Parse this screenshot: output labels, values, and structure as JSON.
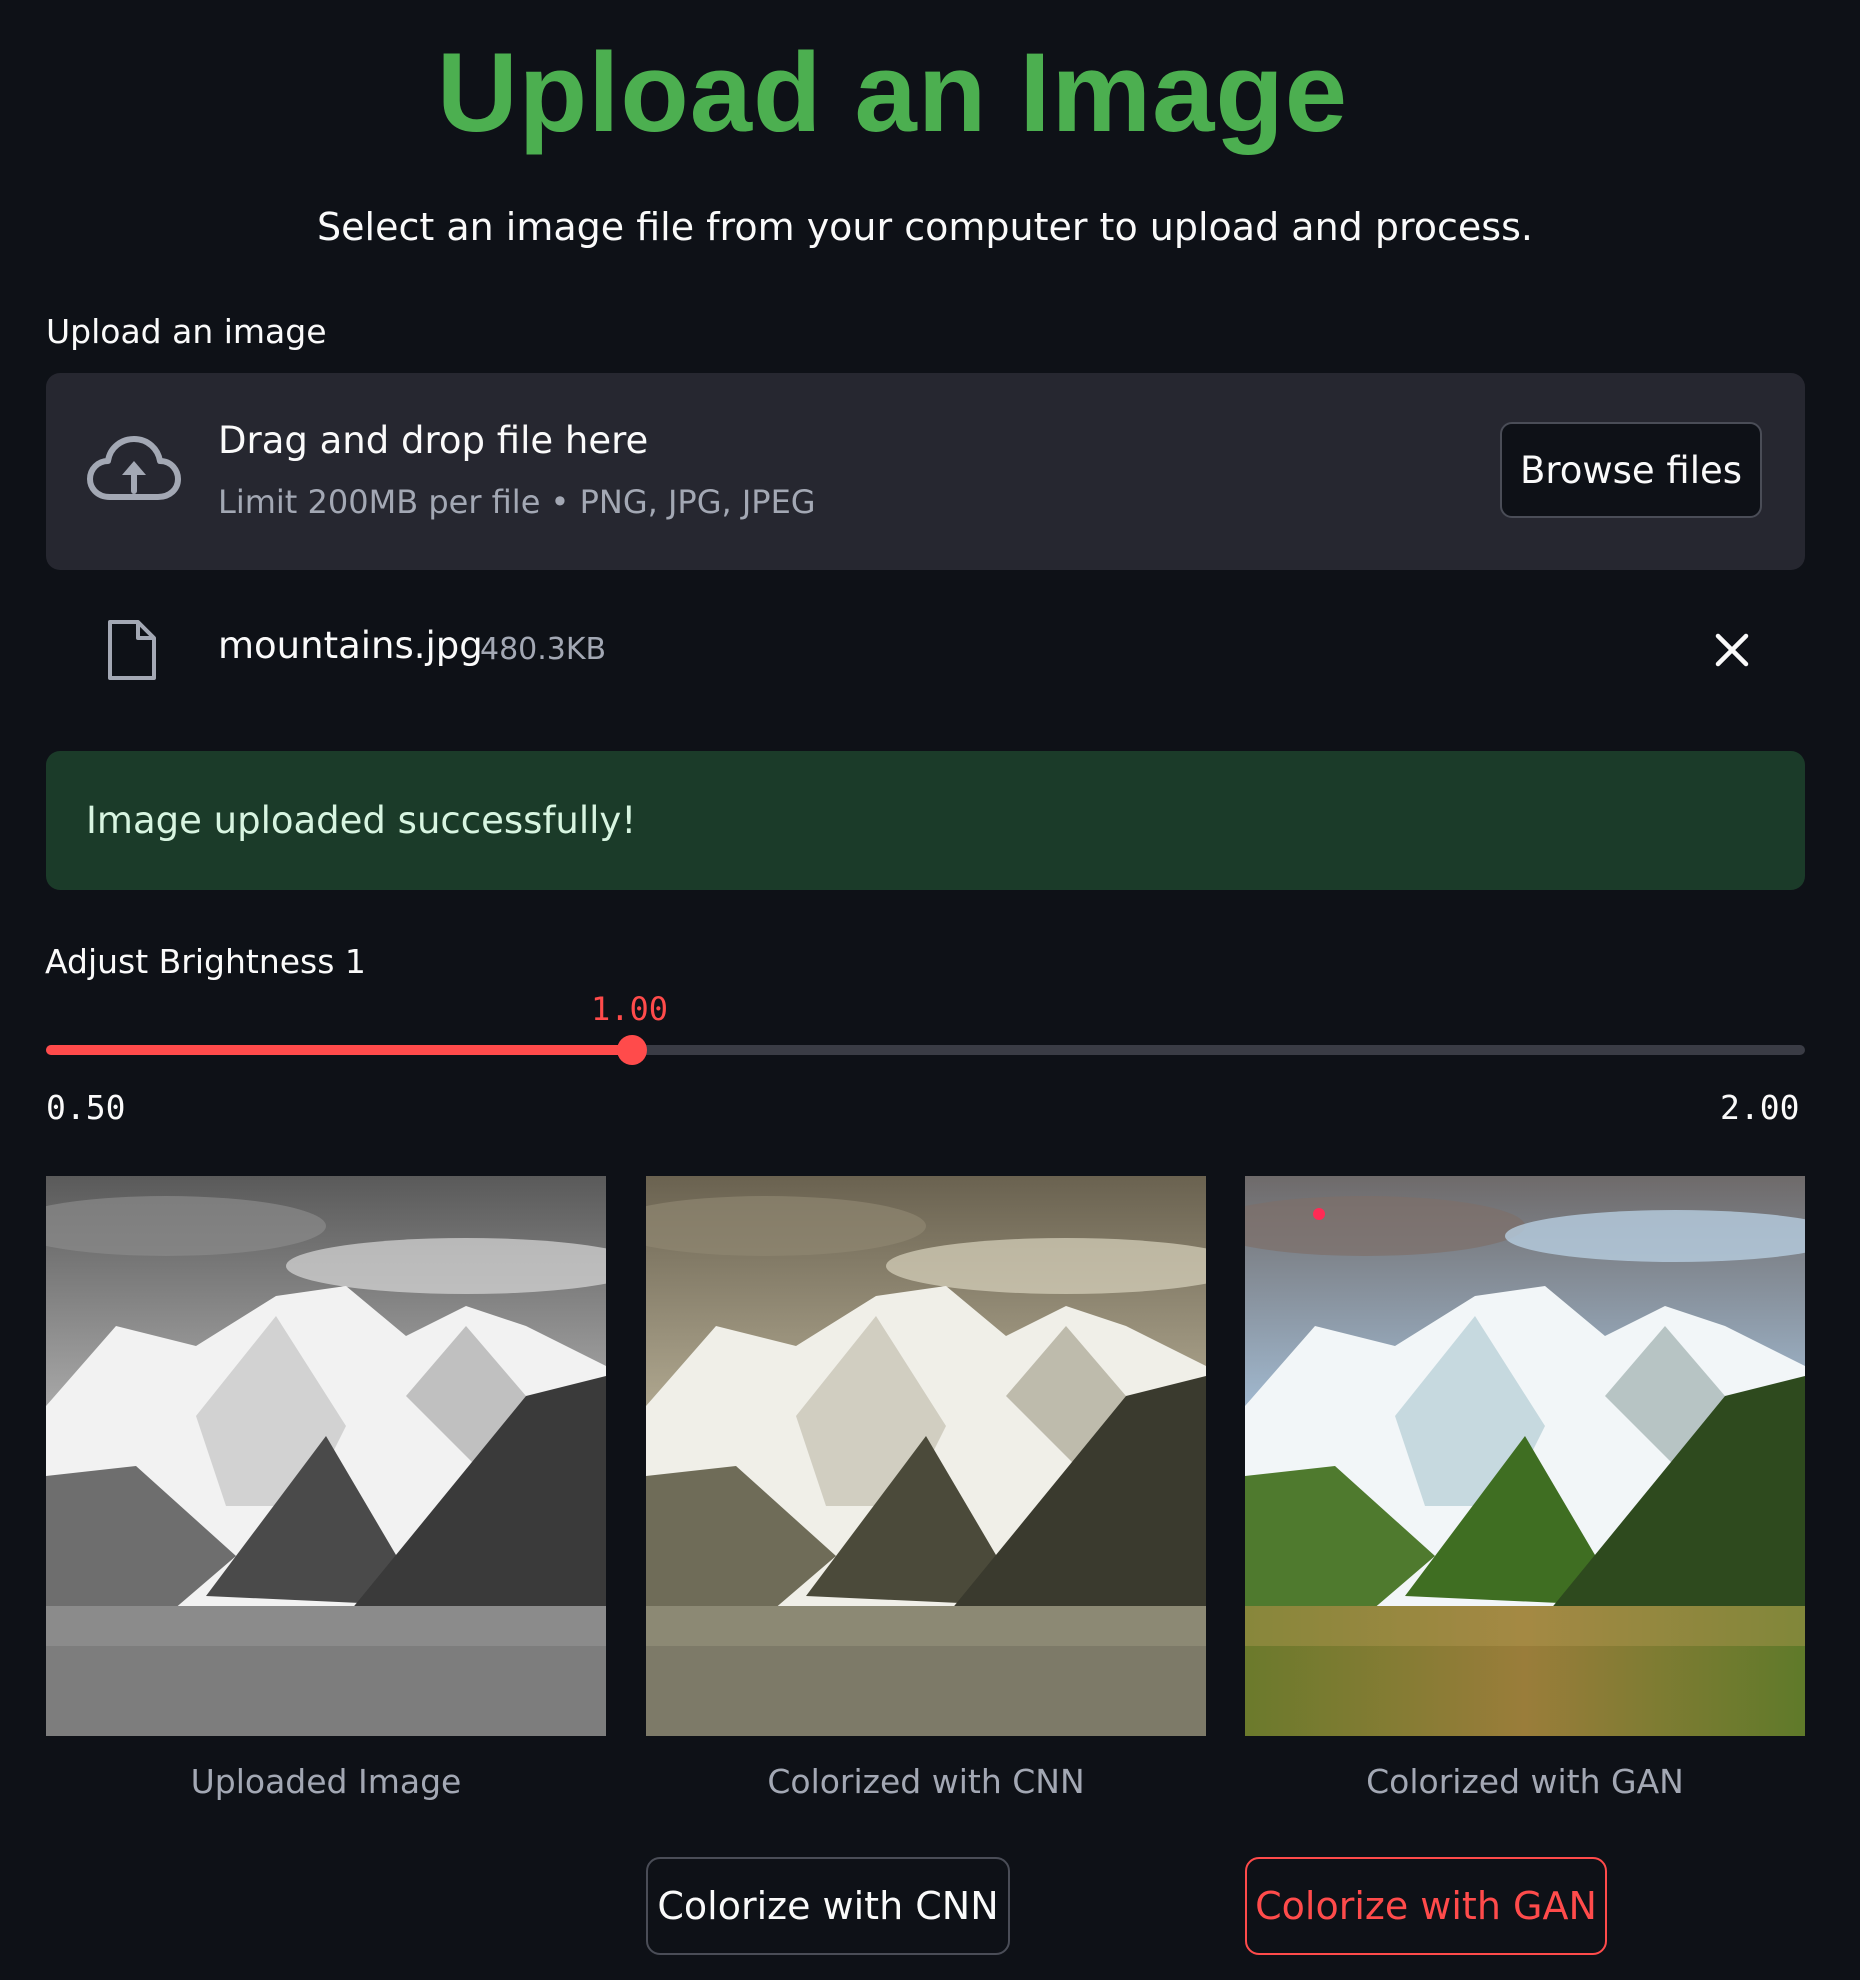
{
  "header": {
    "title": "Upload an Image",
    "subtitle": "Select an image file from your computer to upload and process."
  },
  "uploader": {
    "label": "Upload an image",
    "drop_text": "Drag and drop file here",
    "hint": "Limit 200MB per file • PNG, JPG, JPEG",
    "browse_label": "Browse files",
    "icon": "cloud-upload-icon"
  },
  "uploaded_file": {
    "name": "mountains.jpg",
    "size": "480.3KB",
    "icon": "file-icon",
    "remove_icon": "close-icon"
  },
  "alert": {
    "message": "Image uploaded successfully!",
    "color": "#1b3b29"
  },
  "slider": {
    "label": "Adjust Brightness 1",
    "value": 1.0,
    "value_text": "1.00",
    "min": 0.5,
    "min_text": "0.50",
    "max": 2.0,
    "max_text": "2.00",
    "accent_color": "#ff4b4b"
  },
  "images": [
    {
      "caption": "Uploaded Image",
      "variant": "grayscale"
    },
    {
      "caption": "Colorized with CNN",
      "variant": "sepia"
    },
    {
      "caption": "Colorized with GAN",
      "variant": "color"
    }
  ],
  "actions": {
    "cnn_label": "Colorize with CNN",
    "gan_label": "Colorize with GAN"
  },
  "colors": {
    "background": "#0e1117",
    "title": "#4caf50",
    "primary": "#ff4b4b"
  }
}
